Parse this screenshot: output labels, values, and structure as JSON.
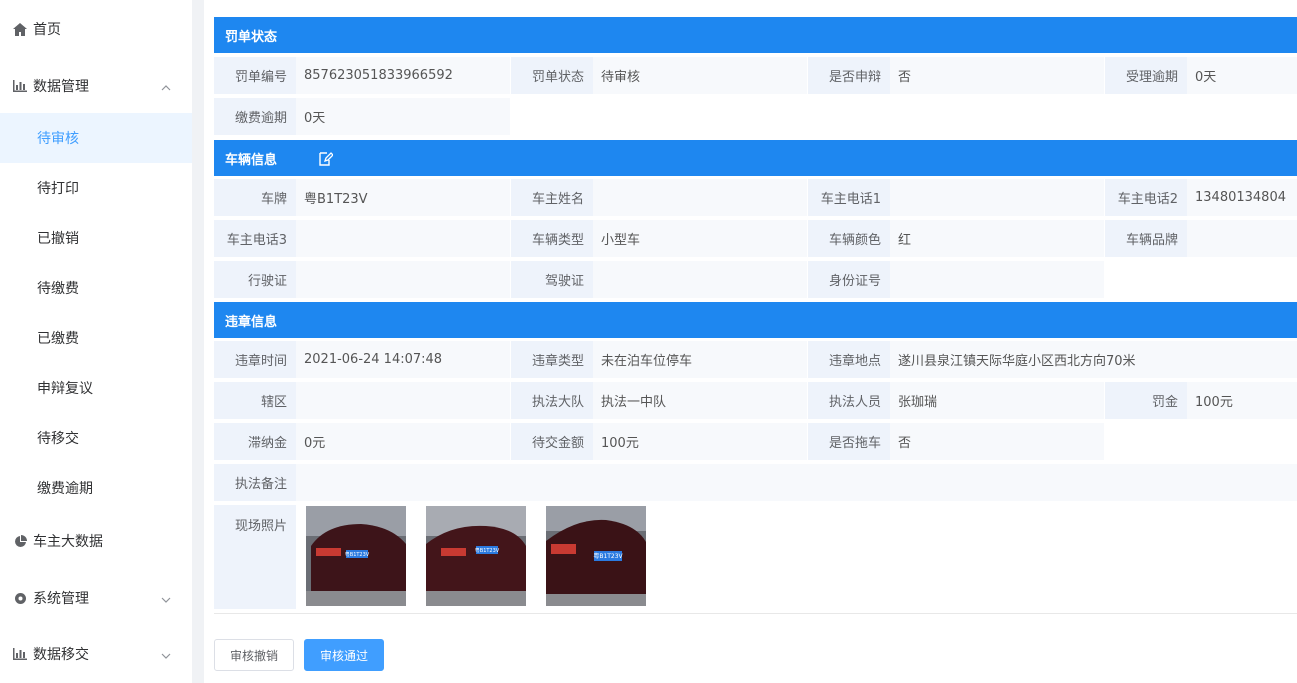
{
  "sidebar": {
    "home": "首页",
    "data_mgmt": "数据管理",
    "sub_items": [
      "待审核",
      "待打印",
      "已撤销",
      "待缴费",
      "已缴费",
      "申辩复议",
      "待移交",
      "缴费逾期"
    ],
    "owner_bigdata": "车主大数据",
    "system_mgmt": "系统管理",
    "data_transfer": "数据移交"
  },
  "sections": {
    "ticket_status": "罚单状态",
    "vehicle_info": "车辆信息",
    "violation_info": "违章信息"
  },
  "ticket": {
    "no_label": "罚单编号",
    "no_value": "857623051833966592",
    "status_label": "罚单状态",
    "status_value": "待审核",
    "appeal_label": "是否申辩",
    "appeal_value": "否",
    "accept_overdue_label": "受理逾期",
    "accept_overdue_value": "0天",
    "pay_overdue_label": "缴费逾期",
    "pay_overdue_value": "0天"
  },
  "vehicle": {
    "plate_label": "车牌",
    "plate_value": "粤B1T23V",
    "owner_name_label": "车主姓名",
    "owner_name_value": "",
    "phone1_label": "车主电话1",
    "phone1_value": "",
    "phone2_label": "车主电话2",
    "phone2_value": "13480134804",
    "phone3_label": "车主电话3",
    "phone3_value": "",
    "type_label": "车辆类型",
    "type_value": "小型车",
    "color_label": "车辆颜色",
    "color_value": "红",
    "brand_label": "车辆品牌",
    "brand_value": "",
    "license_label": "行驶证",
    "license_value": "",
    "driver_label": "驾驶证",
    "driver_value": "",
    "id_label": "身份证号",
    "id_value": ""
  },
  "violation": {
    "time_label": "违章时间",
    "time_value": "2021-06-24 14:07:48",
    "type_label": "违章类型",
    "type_value": "未在泊车位停车",
    "place_label": "违章地点",
    "place_value": "遂川县泉江镇天际华庭小区西北方向70米",
    "district_label": "辖区",
    "district_value": "",
    "team_label": "执法大队",
    "team_value": "执法一中队",
    "officer_label": "执法人员",
    "officer_value": "张珈瑞",
    "fine_label": "罚金",
    "fine_value": "100元",
    "late_label": "滞纳金",
    "late_value": "0元",
    "due_label": "待交金额",
    "due_value": "100元",
    "tow_label": "是否拖车",
    "tow_value": "否",
    "remark_label": "执法备注",
    "remark_value": "",
    "photos_label": "现场照片",
    "photo_plates": [
      "粤B1T23V",
      "粤B1T23V",
      "粤B1T23V"
    ]
  },
  "buttons": {
    "revoke": "审核撤销",
    "pass": "审核通过"
  },
  "colors": {
    "section_bar": "#1e87f0",
    "primary": "#409eff",
    "active_bg": "#ecf5ff"
  }
}
